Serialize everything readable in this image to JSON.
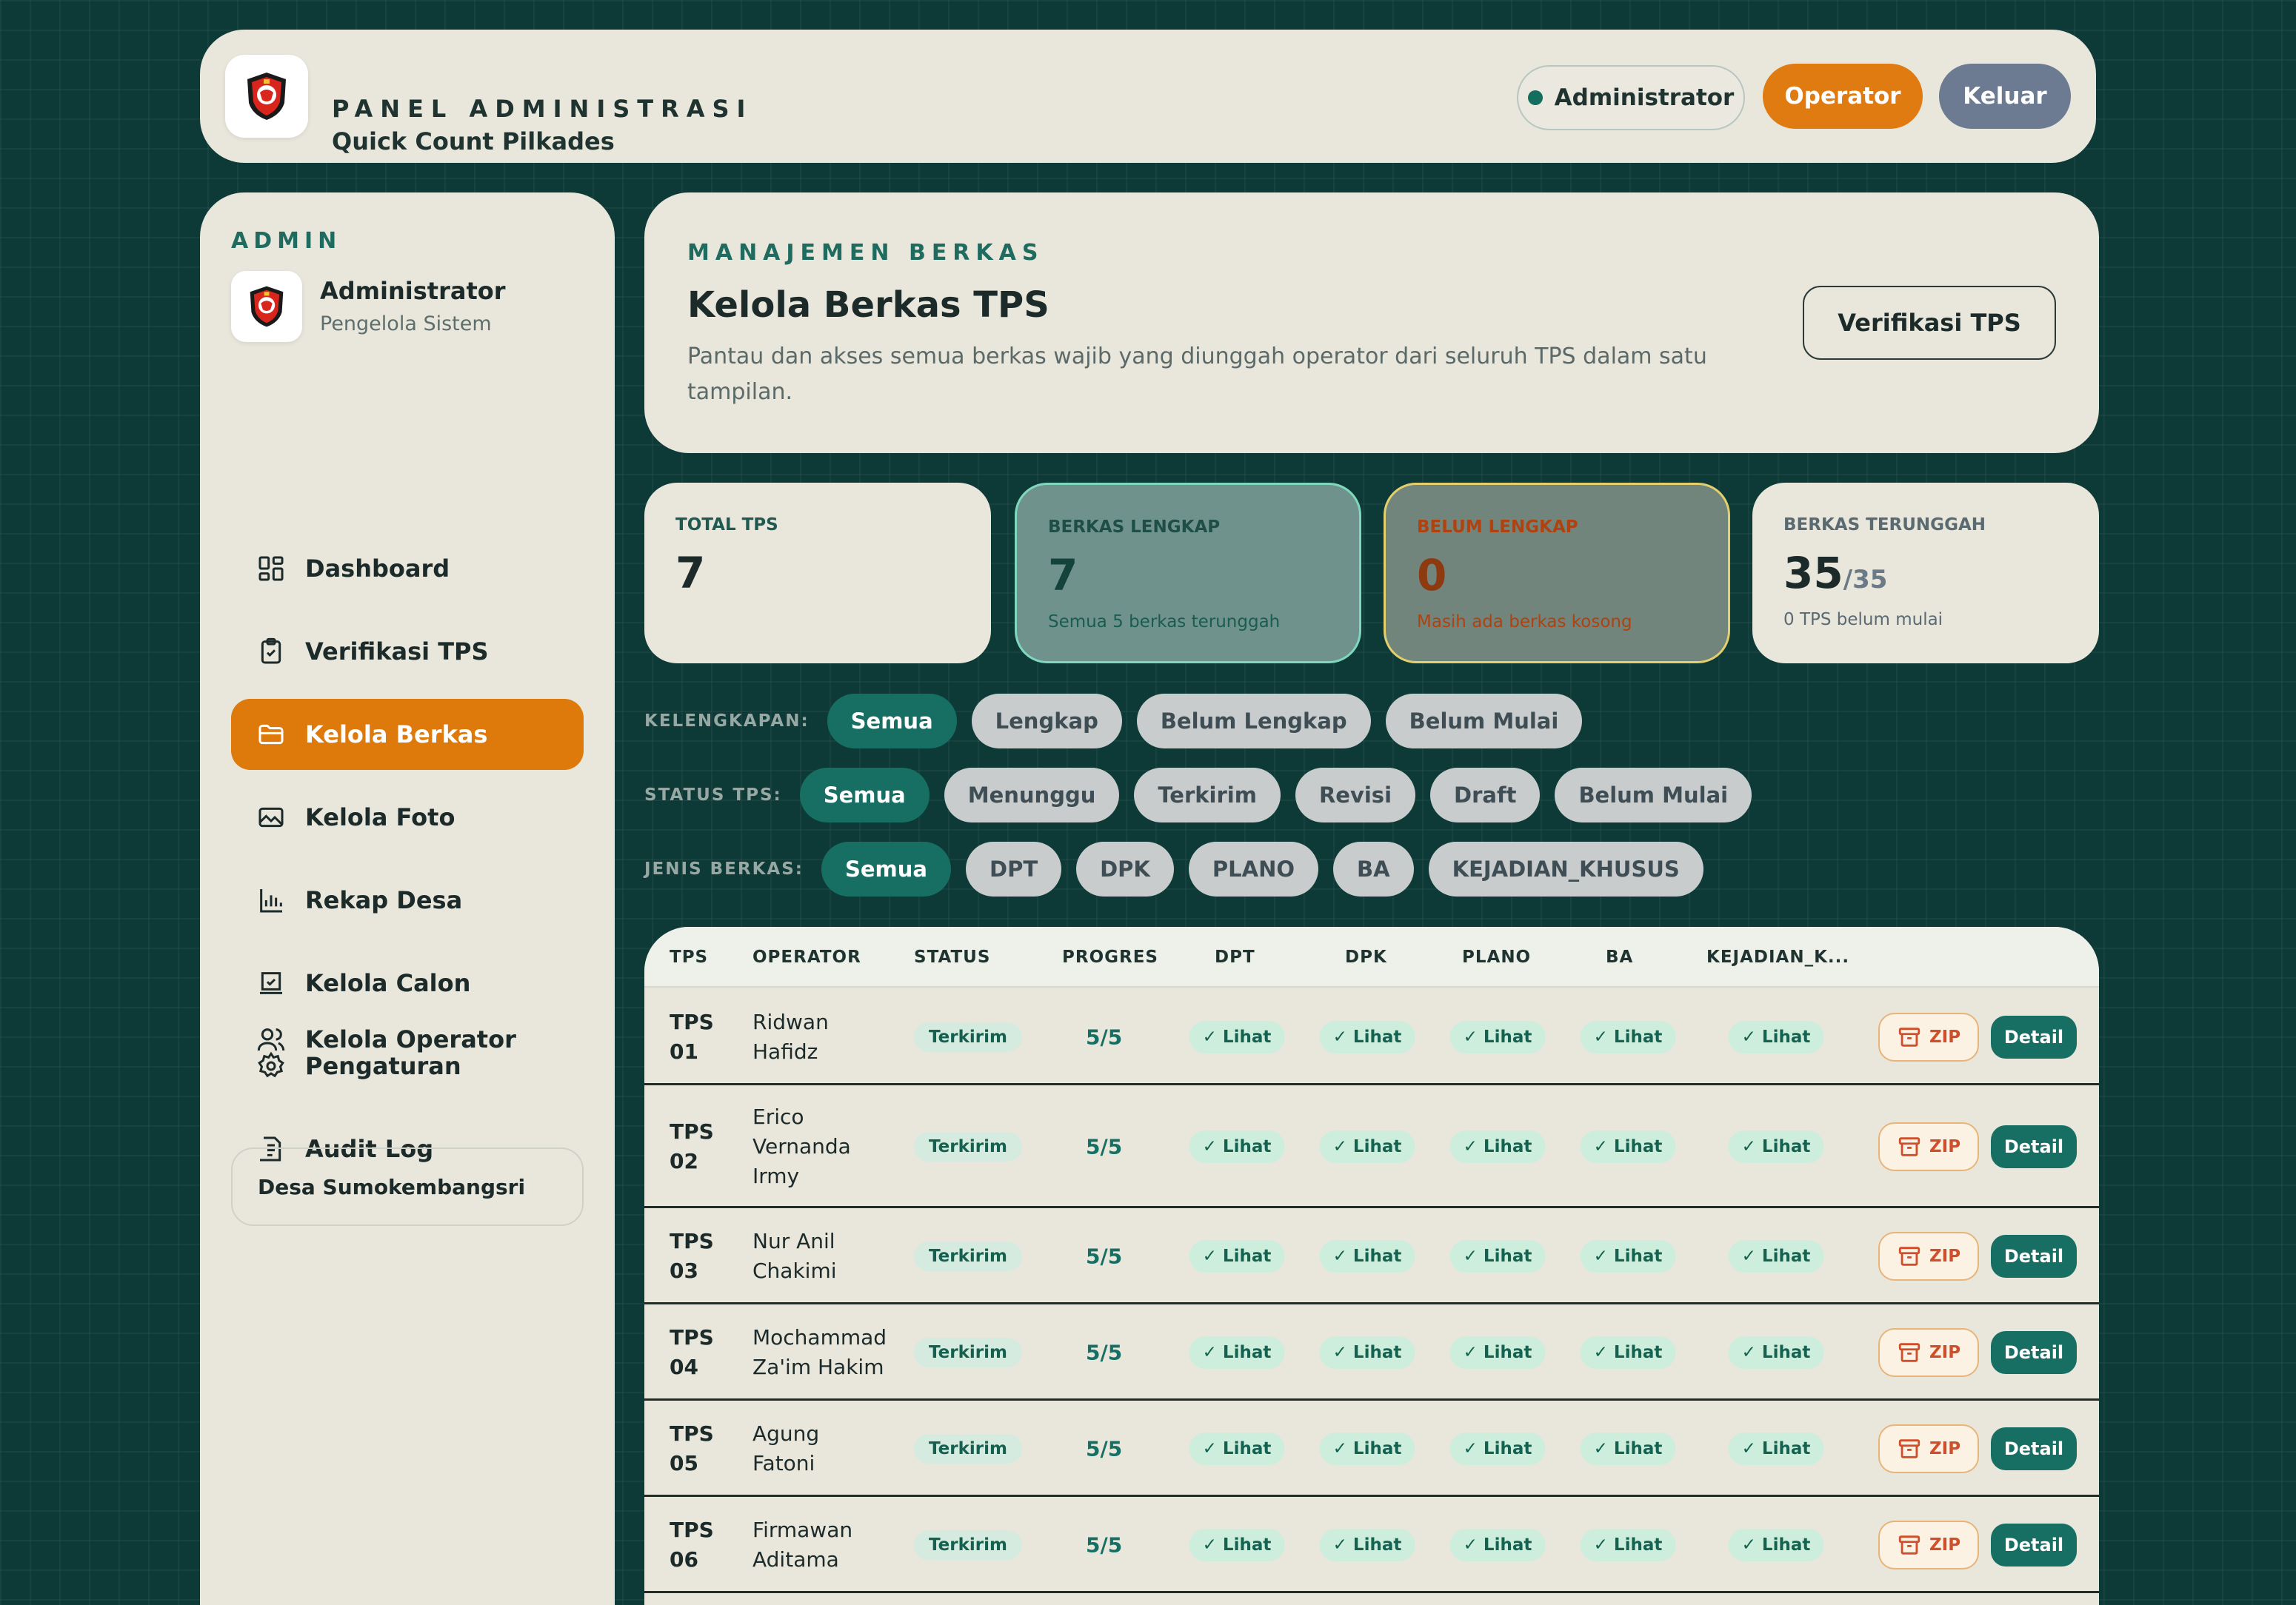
{
  "header": {
    "eyebrow": "PANEL ADMINISTRASI",
    "title": "Quick Count Pilkades",
    "role_badge": "Administrator",
    "operator_button": "Operator",
    "logout_button": "Keluar"
  },
  "sidebar": {
    "eyebrow": "ADMIN",
    "user_name": "Administrator",
    "user_role": "Pengelola Sistem",
    "items": [
      {
        "label": "Dashboard",
        "icon": "dashboard-icon"
      },
      {
        "label": "Verifikasi TPS",
        "icon": "clipboard-check-icon"
      },
      {
        "label": "Kelola Berkas",
        "icon": "folder-icon",
        "active": true
      },
      {
        "label": "Kelola Foto",
        "icon": "photo-icon"
      },
      {
        "label": "Rekap Desa",
        "icon": "bar-chart-icon"
      },
      {
        "label": "Kelola Calon",
        "icon": "ballot-icon"
      },
      {
        "label": "Pengaturan",
        "icon": "gear-icon"
      },
      {
        "label": "Audit Log",
        "icon": "log-icon"
      },
      {
        "label": "Kelola Operator",
        "icon": "users-icon"
      }
    ],
    "village": "Desa Sumokembangsri"
  },
  "hero": {
    "eyebrow": "MANAJEMEN BERKAS",
    "title": "Kelola Berkas TPS",
    "description": "Pantau dan akses semua berkas wajib yang diunggah operator dari seluruh TPS dalam satu tampilan.",
    "button": "Verifikasi TPS"
  },
  "stats": {
    "total": {
      "label": "TOTAL TPS",
      "value": "7"
    },
    "lengkap": {
      "label": "BERKAS LENGKAP",
      "value": "7",
      "sub": "Semua 5 berkas terunggah"
    },
    "belum": {
      "label": "BELUM LENGKAP",
      "value": "0",
      "sub": "Masih ada berkas kosong"
    },
    "terunggah": {
      "label": "BERKAS TERUNGGAH",
      "value": "35",
      "value_total": "/35",
      "sub": "0 TPS belum mulai"
    }
  },
  "filters": {
    "kelengkapan": {
      "label": "KELENGKAPAN:",
      "options": [
        "Semua",
        "Lengkap",
        "Belum Lengkap",
        "Belum Mulai"
      ],
      "active": "Semua"
    },
    "status": {
      "label": "STATUS TPS:",
      "options": [
        "Semua",
        "Menunggu",
        "Terkirim",
        "Revisi",
        "Draft",
        "Belum Mulai"
      ],
      "active": "Semua"
    },
    "jenis": {
      "label": "JENIS BERKAS:",
      "options": [
        "Semua",
        "DPT",
        "DPK",
        "PLANO",
        "BA",
        "KEJADIAN_KHUSUS"
      ],
      "active": "Semua"
    }
  },
  "table": {
    "columns": [
      "TPS",
      "OPERATOR",
      "STATUS",
      "PROGRES",
      "DPT",
      "DPK",
      "PLANO",
      "BA",
      "KEJADIAN_K..."
    ],
    "lihat_label": "✓ Lihat",
    "zip_label": "ZIP",
    "detail_label": "Detail",
    "rows": [
      {
        "tps": [
          "TPS",
          "01"
        ],
        "operator": [
          "Ridwan",
          "Hafidz"
        ],
        "status": "Terkirim",
        "progress": "5/5"
      },
      {
        "tps": [
          "TPS",
          "02"
        ],
        "operator": [
          "Erico",
          "Vernanda",
          "Irmy"
        ],
        "status": "Terkirim",
        "progress": "5/5"
      },
      {
        "tps": [
          "TPS",
          "03"
        ],
        "operator": [
          "Nur Anil",
          "Chakimi"
        ],
        "status": "Terkirim",
        "progress": "5/5"
      },
      {
        "tps": [
          "TPS",
          "04"
        ],
        "operator": [
          "Mochammad",
          "Za'im Hakim"
        ],
        "status": "Terkirim",
        "progress": "5/5"
      },
      {
        "tps": [
          "TPS",
          "05"
        ],
        "operator": [
          "Agung",
          "Fatoni"
        ],
        "status": "Terkirim",
        "progress": "5/5"
      },
      {
        "tps": [
          "TPS",
          "06"
        ],
        "operator": [
          "Firmawan",
          "Aditama"
        ],
        "status": "Terkirim",
        "progress": "5/5"
      }
    ]
  }
}
